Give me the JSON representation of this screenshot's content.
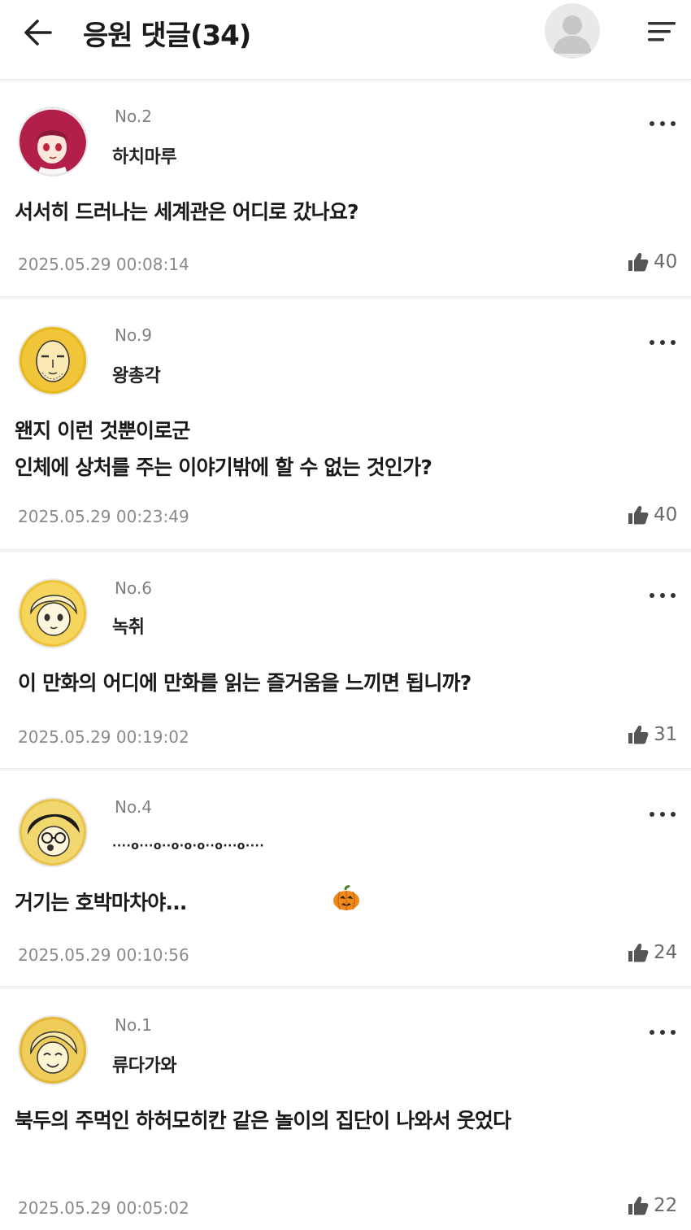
{
  "header": {
    "title": "응원 댓글(34)",
    "back_icon": "arrow-left-icon",
    "profile_icon": "user-avatar-icon",
    "menu_icon": "sort-menu-icon"
  },
  "colors": {
    "text_primary": "#1a1a1a",
    "text_secondary": "#8a8a8a",
    "divider": "#ececec"
  },
  "comments": [
    {
      "no": "No.2",
      "nickname": "하치마루",
      "lines": [
        "서서히 드러나는 세계관은 어디로 갔나요?"
      ],
      "date": "2025.05.29 00:08:14",
      "likes": "40",
      "avatar_icon": "anime-girl-avatar-icon"
    },
    {
      "no": "No.9",
      "nickname": "왕총각",
      "lines": [
        "왠지 이런 것뿐이로군",
        "인체에 상처를 주는 이야기밖에 할 수 없는 것인가?"
      ],
      "date": "2025.05.29 00:23:49",
      "likes": "40",
      "avatar_icon": "bald-man-avatar-icon"
    },
    {
      "no": "No.6",
      "nickname": "녹취",
      "lines": [
        "이 만화의 어디에 만화를 읽는 즐거움을 느끼면 됩니까?"
      ],
      "date": "2025.05.29 00:19:02",
      "likes": "31",
      "avatar_icon": "anime-boy-avatar-icon"
    },
    {
      "no": "No.4",
      "nickname": "····o···o··o·o·o··o···o····",
      "lines": [
        "거기는 호박마차야..."
      ],
      "date": "2025.05.29 00:10:56",
      "likes": "24",
      "avatar_icon": "glasses-boy-avatar-icon",
      "emoji_icon": "pumpkin-icon"
    },
    {
      "no": "No.1",
      "nickname": "류다가와",
      "lines": [
        "북두의 주먹인 하허모히칸 같은 놀이의 집단이 나와서 웃었다"
      ],
      "date": "2025.05.29 00:05:02",
      "likes": "22",
      "avatar_icon": "smiling-boy-avatar-icon"
    }
  ]
}
